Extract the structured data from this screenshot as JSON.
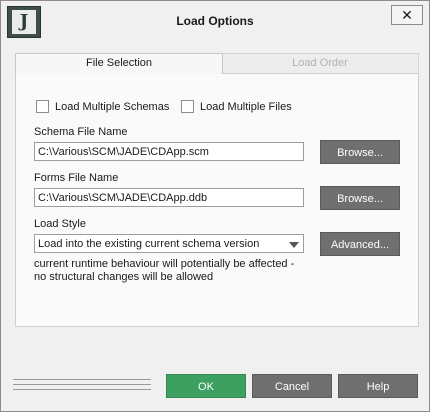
{
  "window": {
    "title": "Load Options",
    "app_icon_letter": "J",
    "close_symbol": "✕"
  },
  "tabs": [
    {
      "label": "File Selection",
      "active": true
    },
    {
      "label": "Load Order",
      "active": false
    }
  ],
  "options": {
    "load_multiple_schemas": {
      "label": "Load Multiple Schemas",
      "checked": false
    },
    "load_multiple_files": {
      "label": "Load Multiple Files",
      "checked": false
    }
  },
  "schema_file": {
    "label": "Schema File Name",
    "value": "C:\\Various\\SCM\\JADE\\CDApp.scm",
    "browse_label": "Browse..."
  },
  "forms_file": {
    "label": "Forms File Name",
    "value": "C:\\Various\\SCM\\JADE\\CDApp.ddb",
    "browse_label": "Browse..."
  },
  "load_style": {
    "label": "Load Style",
    "selected": "Load into the existing current schema version",
    "advanced_label": "Advanced...",
    "description_line1": "current runtime behaviour will potentially be affected -",
    "description_line2": "no structural changes will be allowed"
  },
  "footer": {
    "ok_label": "OK",
    "cancel_label": "Cancel",
    "help_label": "Help"
  },
  "colors": {
    "ok": "#3da060",
    "button_dark": "#6f6f6f",
    "background": "#f0f0f0"
  }
}
